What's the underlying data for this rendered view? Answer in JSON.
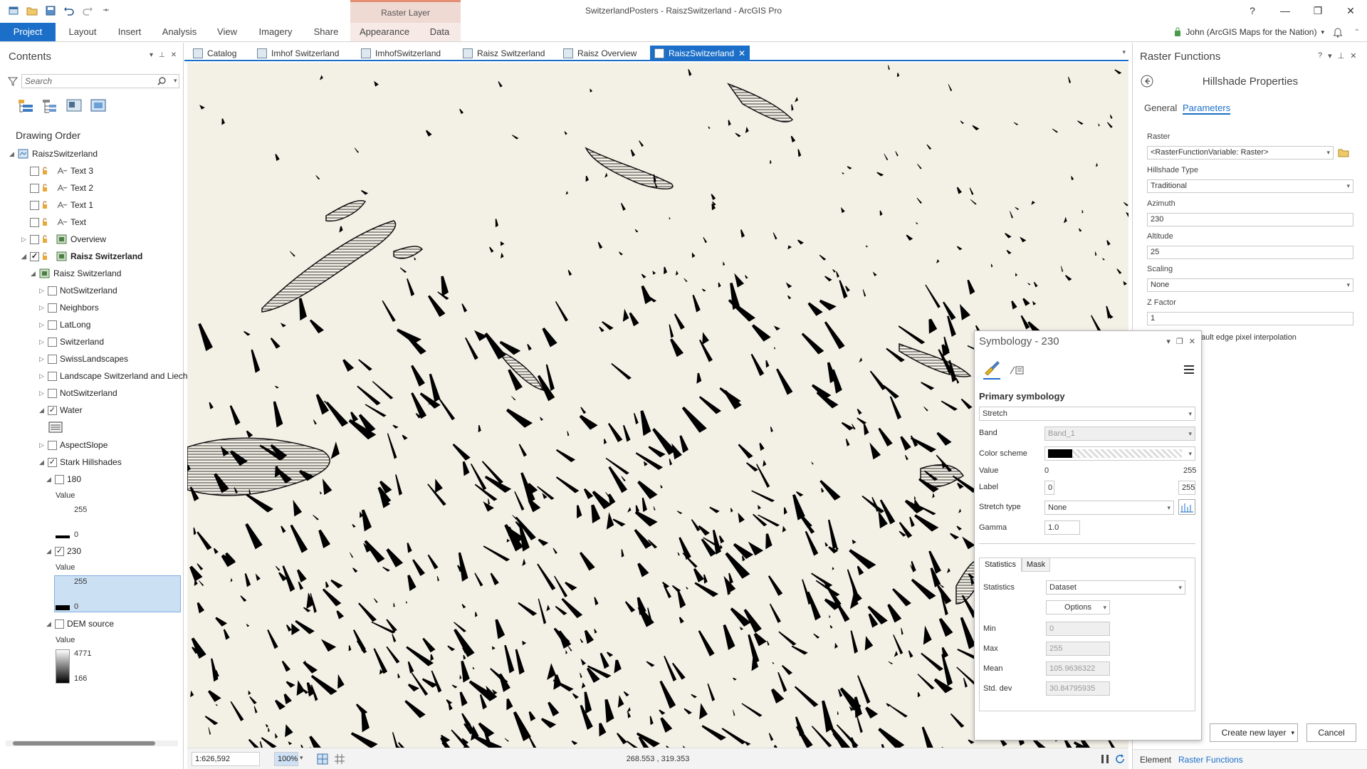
{
  "titlebar": {
    "window_title": "SwitzerlandPosters - RaiszSwitzerland - ArcGIS Pro",
    "context_tab_group": "Raster Layer",
    "help": "?",
    "minimize": "—",
    "restore": "❐",
    "close": "✕"
  },
  "ribbon": {
    "tabs": [
      "Project",
      "Layout",
      "Insert",
      "Analysis",
      "View",
      "Imagery",
      "Share",
      "Appearance",
      "Data"
    ],
    "user": "John (ArcGIS Maps for the Nation)"
  },
  "contents": {
    "title": "Contents",
    "search_placeholder": "Search",
    "drawing_order": "Drawing Order",
    "map": "RaiszSwitzerland",
    "items": [
      {
        "label": "Text 3"
      },
      {
        "label": "Text 2"
      },
      {
        "label": "Text 1"
      },
      {
        "label": "Text"
      },
      {
        "label": "Overview"
      },
      {
        "label": "Raisz Switzerland"
      },
      {
        "label": "Raisz Switzerland"
      },
      {
        "label": "NotSwitzerland"
      },
      {
        "label": "Neighbors"
      },
      {
        "label": "LatLong"
      },
      {
        "label": "Switzerland"
      },
      {
        "label": "SwissLandscapes"
      },
      {
        "label": "Landscape Switzerland and Liech"
      },
      {
        "label": "NotSwitzerland"
      },
      {
        "label": "Water"
      },
      {
        "label": "AspectSlope"
      },
      {
        "label": "Stark Hillshades"
      },
      {
        "label": "180"
      },
      {
        "label": "230"
      },
      {
        "label": "DEM source"
      }
    ],
    "legend_value": "Value",
    "hs180_high": "255",
    "hs180_low": "0",
    "hs230_high": "255",
    "hs230_low": "0",
    "dem_high": "4771",
    "dem_low": "166"
  },
  "view_tabs": [
    "Catalog",
    "Imhof Switzerland",
    "ImhofSwitzerland",
    "Raisz Switzerland",
    "Raisz Overview",
    "RaiszSwitzerland"
  ],
  "statusbar": {
    "scale": "1:626,592",
    "zoom": "100%",
    "coords": "268.553 , 319.353"
  },
  "raster_functions": {
    "title": "Raster Functions",
    "subtitle": "Hillshade Properties",
    "tab_general": "General",
    "tab_parameters": "Parameters",
    "raster_label": "Raster",
    "raster_value": "<RasterFunctionVariable: Raster>",
    "hillshade_type_label": "Hillshade Type",
    "hillshade_type_value": "Traditional",
    "azimuth_label": "Azimuth",
    "azimuth_value": "230",
    "altitude_label": "Altitude",
    "altitude_value": "25",
    "scaling_label": "Scaling",
    "scaling_value": "None",
    "zfactor_label": "Z Factor",
    "zfactor_value": "1",
    "edge_text": "ault edge pixel interpolation",
    "create_button": "Create new layer",
    "cancel_button": "Cancel",
    "bottom_tab_element": "Element",
    "bottom_tab_rf": "Raster Functions"
  },
  "symbology": {
    "title": "Symbology - 230",
    "primary": "Primary symbology",
    "renderer": "Stretch",
    "band_label": "Band",
    "band_value": "Band_1",
    "color_scheme_label": "Color scheme",
    "value_label": "Value",
    "value_min": "0",
    "value_max": "255",
    "label_label": "Label",
    "label_min": "0",
    "label_max": "255",
    "stretch_type_label": "Stretch type",
    "stretch_type_value": "None",
    "gamma_label": "Gamma",
    "gamma_value": "1.0",
    "tab_statistics": "Statistics",
    "tab_mask": "Mask",
    "statistics_label": "Statistics",
    "statistics_value": "Dataset",
    "options_button": "Options",
    "min_label": "Min",
    "min_value": "0",
    "max_label": "Max",
    "max_value": "255",
    "mean_label": "Mean",
    "mean_value": "105.9636322",
    "stddev_label": "Std. dev",
    "stddev_value": "30.84795935"
  },
  "colors": {
    "accent": "#1b6fc8",
    "context_tab": "#e48f74",
    "map_paper": "#f3f0e6",
    "selection": "#cce0f4"
  }
}
